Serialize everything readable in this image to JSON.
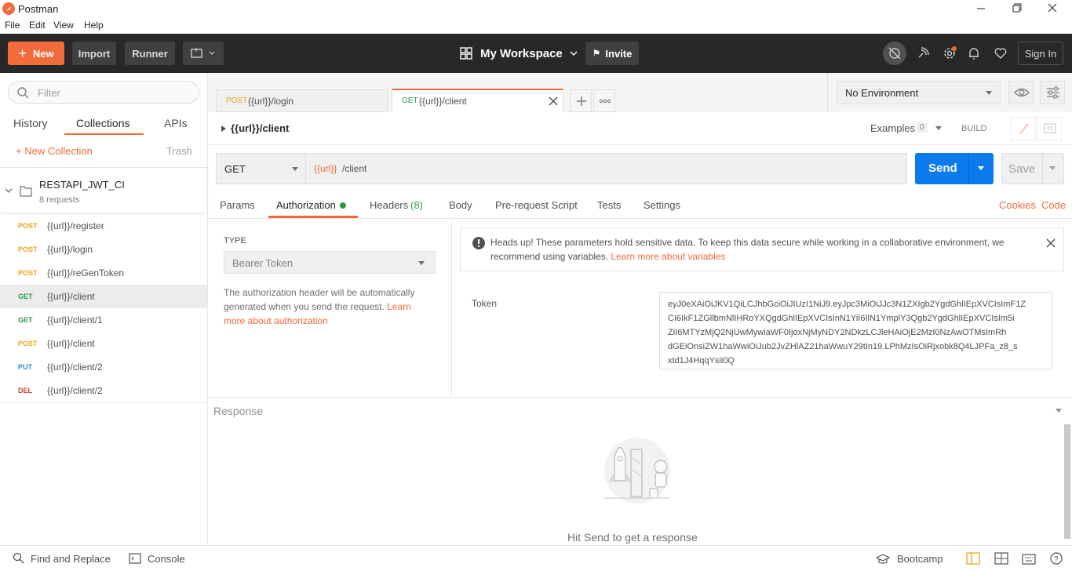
{
  "window": {
    "title": "Postman"
  },
  "menu": [
    "File",
    "Edit",
    "View",
    "Help"
  ],
  "header": {
    "new_label": "New",
    "import_label": "Import",
    "runner_label": "Runner",
    "workspace_label": "My Workspace",
    "invite_label": "Invite",
    "signin_label": "Sign In"
  },
  "sidebar": {
    "filter_placeholder": "Filter",
    "tabs": [
      "History",
      "Collections",
      "APIs"
    ],
    "active_tab": "Collections",
    "new_collection_label": "+ New Collection",
    "trash_label": "Trash",
    "collection": {
      "name": "RESTAPI_JWT_CI",
      "count": "8 requests"
    },
    "requests": [
      {
        "method": "POST",
        "url": "{{url}}/register"
      },
      {
        "method": "POST",
        "url": "{{url}}/login"
      },
      {
        "method": "POST",
        "url": "{{url}}/reGenToken"
      },
      {
        "method": "GET",
        "url": "{{url}}/client"
      },
      {
        "method": "GET",
        "url": "{{url}}/client/1"
      },
      {
        "method": "POST",
        "url": "{{url}}/client"
      },
      {
        "method": "PUT",
        "url": "{{url}}/client/2"
      },
      {
        "method": "DEL",
        "url": "{{url}}/client/2"
      }
    ],
    "selected_index": 3
  },
  "tabs": [
    {
      "method": "POST",
      "label": "{{url}}/login"
    },
    {
      "method": "GET",
      "label": "{{url}}/client"
    }
  ],
  "environment": {
    "label": "No Environment"
  },
  "request": {
    "breadcrumb": "{{url}}/client",
    "examples_label": "Examples",
    "examples_count": "0",
    "build_label": "BUILD",
    "method": "GET",
    "url_var": "{{url}}",
    "url_path": "/client",
    "send_label": "Send",
    "save_label": "Save"
  },
  "req_tabs": {
    "params": "Params",
    "authorization": "Authorization",
    "headers": "Headers",
    "headers_count": "(8)",
    "body": "Body",
    "prerequest": "Pre-request Script",
    "tests": "Tests",
    "settings": "Settings",
    "cookies": "Cookies",
    "code": "Code"
  },
  "auth": {
    "type_label": "TYPE",
    "type_value": "Bearer Token",
    "description": "The authorization header will be automatically generated when you send the request.",
    "learn_more": "Learn more about authorization",
    "warning_text": "Heads up! These parameters hold sensitive data. To keep this data secure while working in a collaborative environment, we recommend using variables.",
    "warning_link": "Learn more about variables",
    "token_label": "Token",
    "token_lines": [
      "eyJ0eXAiOiJKV1QiLCJhbGciOiJIUzI1NiJ9.eyJpc3MiOiJJc3N1ZXIgb2YgdGhlIEpXVCIsImF1Z",
      "CI6IkF1ZGllbmNlIHRoYXQgdGhlIEpXVCIsInN1YiI6IlN1YmplY3Qgb2YgdGhlIEpXVCIsIm5i",
      "ZiI6MTYzMjQ2NjUwMywiaWF0IjoxNjMyNDY2NDkzLCJleHAiOjE2MzI0NzAwOTMsImRh",
      "dGEiOnsiZW1haWwiOiJub2JvZHlAZ21haWwuY29tIn19.LPhMzIsOiRjxobk8Q4LJPFa_z8_s",
      "xtd1J4HqqYsii0Q"
    ]
  },
  "response": {
    "label": "Response",
    "hint": "Hit Send to get a response"
  },
  "statusbar": {
    "find_replace": "Find and Replace",
    "console": "Console",
    "bootcamp": "Bootcamp"
  },
  "colors": {
    "accent": "#f26b3a",
    "send_blue": "#097bed",
    "header_bg": "#282828",
    "post": "#e8a41e",
    "get": "#2b9a46",
    "put": "#2a8bdb",
    "del": "#d8392e"
  }
}
